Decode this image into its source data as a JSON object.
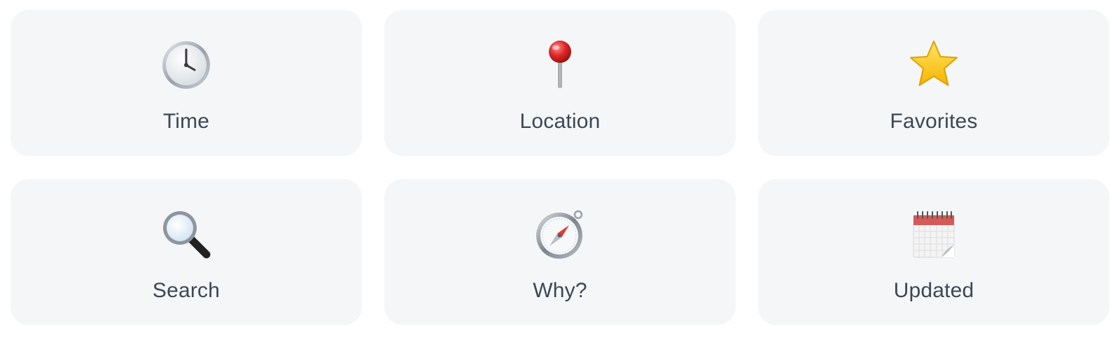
{
  "cards": [
    {
      "label": "Time",
      "icon": "clock-icon"
    },
    {
      "label": "Location",
      "icon": "pushpin-icon"
    },
    {
      "label": "Favorites",
      "icon": "star-icon"
    },
    {
      "label": "Search",
      "icon": "magnifying-glass-icon"
    },
    {
      "label": "Why?",
      "icon": "compass-icon"
    },
    {
      "label": "Updated",
      "icon": "calendar-icon"
    }
  ],
  "colors": {
    "card_background": "#f5f6f8",
    "label_text": "#3e4656",
    "page_background": "#ffffff"
  }
}
